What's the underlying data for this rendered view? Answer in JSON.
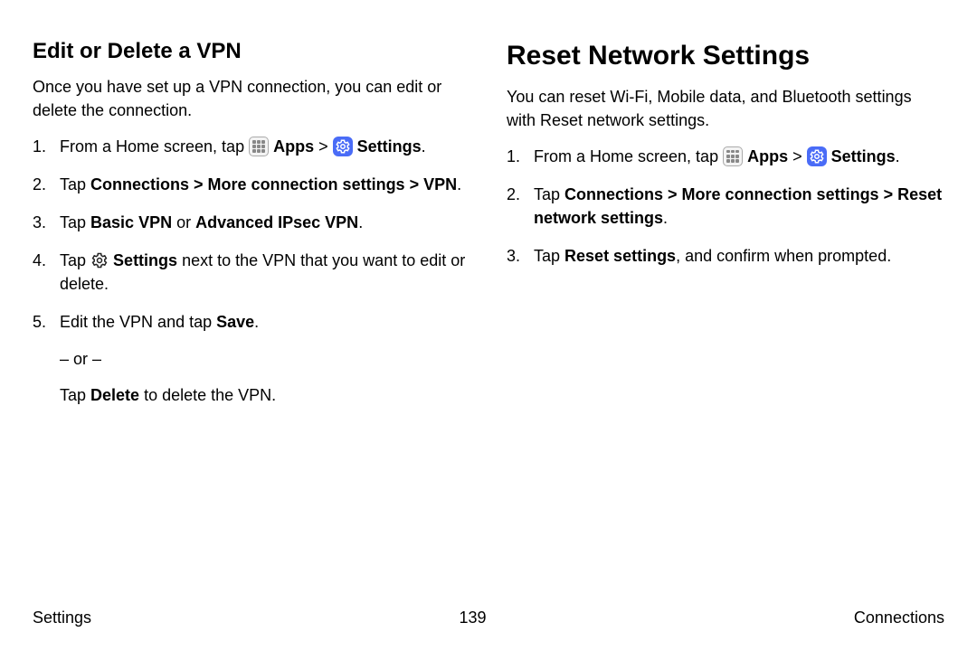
{
  "left": {
    "heading": "Edit or Delete a VPN",
    "intro": "Once you have set up a VPN connection, you can edit or delete the connection.",
    "step1_a": "From a Home screen, tap ",
    "step1_apps": "Apps",
    "step1_gt": " > ",
    "step1_settings": "Settings",
    "step1_end": ".",
    "step2_a": "Tap ",
    "step2_path": "Connections > More connection settings > VPN",
    "step2_end": ".",
    "step3_a": "Tap ",
    "step3_b1": "Basic VPN",
    "step3_or": " or ",
    "step3_b2": "Advanced IPsec VPN",
    "step3_end": ".",
    "step4_a": "Tap ",
    "step4_b": "Settings",
    "step4_c": " next to the VPN that you want to edit or delete.",
    "step5_a": "Edit the VPN and tap ",
    "step5_b": "Save",
    "step5_c": ".",
    "step5_or": "– or –",
    "step5_d": "Tap ",
    "step5_e": "Delete",
    "step5_f": " to delete the VPN."
  },
  "right": {
    "heading": "Reset Network Settings",
    "intro": "You can reset Wi-Fi, Mobile data, and Bluetooth settings with Reset network settings.",
    "step1_a": "From a Home screen, tap ",
    "step1_apps": "Apps",
    "step1_gt": " > ",
    "step1_settings": "Settings",
    "step1_end": ".",
    "step2_a": "Tap ",
    "step2_path": "Connections > More connection settings > Reset network settings",
    "step2_end": ".",
    "step3_a": "Tap ",
    "step3_b": "Reset settings",
    "step3_c": ", and confirm when prompted."
  },
  "footer": {
    "left": "Settings",
    "center": "139",
    "right": "Connections"
  }
}
